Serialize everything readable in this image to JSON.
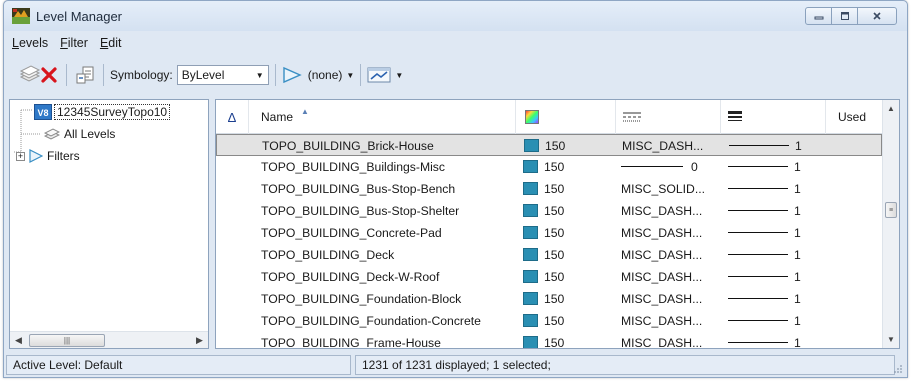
{
  "window": {
    "title": "Level Manager",
    "controls": [
      "minimize",
      "maximize",
      "close"
    ]
  },
  "menu": [
    {
      "prefix": "",
      "mnemonic": "L",
      "rest": "evels"
    },
    {
      "prefix": "",
      "mnemonic": "F",
      "rest": "ilter"
    },
    {
      "prefix": "",
      "mnemonic": "E",
      "rest": "dit"
    }
  ],
  "toolbar": {
    "symbology_label": "Symbology:",
    "symbology_value": "ByLevel",
    "filter_value": "(none)"
  },
  "tree": {
    "root_label": "12345SurveyTopo10",
    "root_badge": "V8",
    "all_levels_label": "All Levels",
    "filters_label": "Filters",
    "filters_expander": "+"
  },
  "grid": {
    "columns": {
      "active": "Δ",
      "name": "Name",
      "used": "Used"
    },
    "rows": [
      {
        "name": "TOPO_BUILDING_Brick-House",
        "color": "150",
        "style": "MISC_DASH...",
        "weight": "1",
        "selected": true
      },
      {
        "name": "TOPO_BUILDING_Buildings-Misc",
        "color": "150",
        "style": "0",
        "weight": "1",
        "selected": false
      },
      {
        "name": "TOPO_BUILDING_Bus-Stop-Bench",
        "color": "150",
        "style": "MISC_SOLID...",
        "weight": "1",
        "selected": false
      },
      {
        "name": "TOPO_BUILDING_Bus-Stop-Shelter",
        "color": "150",
        "style": "MISC_DASH...",
        "weight": "1",
        "selected": false
      },
      {
        "name": "TOPO_BUILDING_Concrete-Pad",
        "color": "150",
        "style": "MISC_DASH...",
        "weight": "1",
        "selected": false
      },
      {
        "name": "TOPO_BUILDING_Deck",
        "color": "150",
        "style": "MISC_DASH...",
        "weight": "1",
        "selected": false
      },
      {
        "name": "TOPO_BUILDING_Deck-W-Roof",
        "color": "150",
        "style": "MISC_DASH...",
        "weight": "1",
        "selected": false
      },
      {
        "name": "TOPO_BUILDING_Foundation-Block",
        "color": "150",
        "style": "MISC_DASH...",
        "weight": "1",
        "selected": false
      },
      {
        "name": "TOPO_BUILDING_Foundation-Concrete",
        "color": "150",
        "style": "MISC_DASH...",
        "weight": "1",
        "selected": false
      },
      {
        "name": "TOPO_BUILDING_Frame-House",
        "color": "150",
        "style": "MISC_DASH...",
        "weight": "1",
        "selected": false
      }
    ]
  },
  "status": {
    "active_level": "Active Level: Default",
    "count": "1231 of 1231 displayed; 1 selected;"
  },
  "colors": {
    "swatch": "#2a8fb3",
    "selection": "#e3e3e3"
  }
}
